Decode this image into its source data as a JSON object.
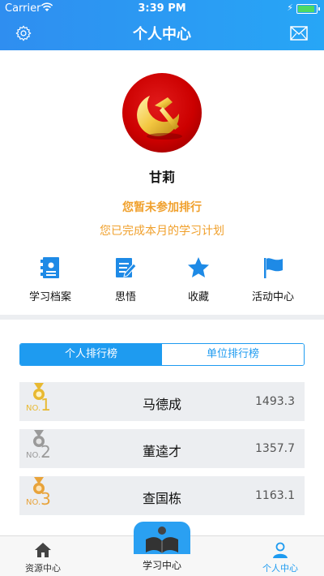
{
  "status": {
    "carrier": "Carrier",
    "time": "3:39 PM"
  },
  "header": {
    "title": "个人中心",
    "settings_icon": "gear-icon",
    "mail_icon": "mail-icon"
  },
  "profile": {
    "avatar_icon": "party-emblem-icon",
    "name": "甘莉",
    "rank_note": "您暂未参加排行",
    "plan_note": "您已完成本月的学习计划"
  },
  "quick_actions": [
    {
      "label": "学习档案",
      "icon": "archive-icon"
    },
    {
      "label": "思悟",
      "icon": "notes-icon"
    },
    {
      "label": "收藏",
      "icon": "star-icon"
    },
    {
      "label": "活动中心",
      "icon": "flag-icon"
    }
  ],
  "tabs": [
    {
      "label": "个人排行榜",
      "active": true
    },
    {
      "label": "单位排行榜",
      "active": false
    }
  ],
  "ranking": [
    {
      "no_prefix": "NO.",
      "no": "1",
      "name": "马德成",
      "score": "1493.3",
      "color": "#e8b931"
    },
    {
      "no_prefix": "NO.",
      "no": "2",
      "name": "董逵才",
      "score": "1357.7",
      "color": "#9a9a9a"
    },
    {
      "no_prefix": "NO.",
      "no": "3",
      "name": "查国栋",
      "score": "1163.1",
      "color": "#e8a33a"
    }
  ],
  "tabbar": {
    "left": {
      "label": "资源中心",
      "icon": "home-icon"
    },
    "center": {
      "label": "学习中心",
      "icon": "book-icon"
    },
    "right": {
      "label": "个人中心",
      "icon": "person-icon"
    }
  },
  "colors": {
    "primary": "#1e9bf0",
    "accent_orange": "#f0a02c"
  }
}
